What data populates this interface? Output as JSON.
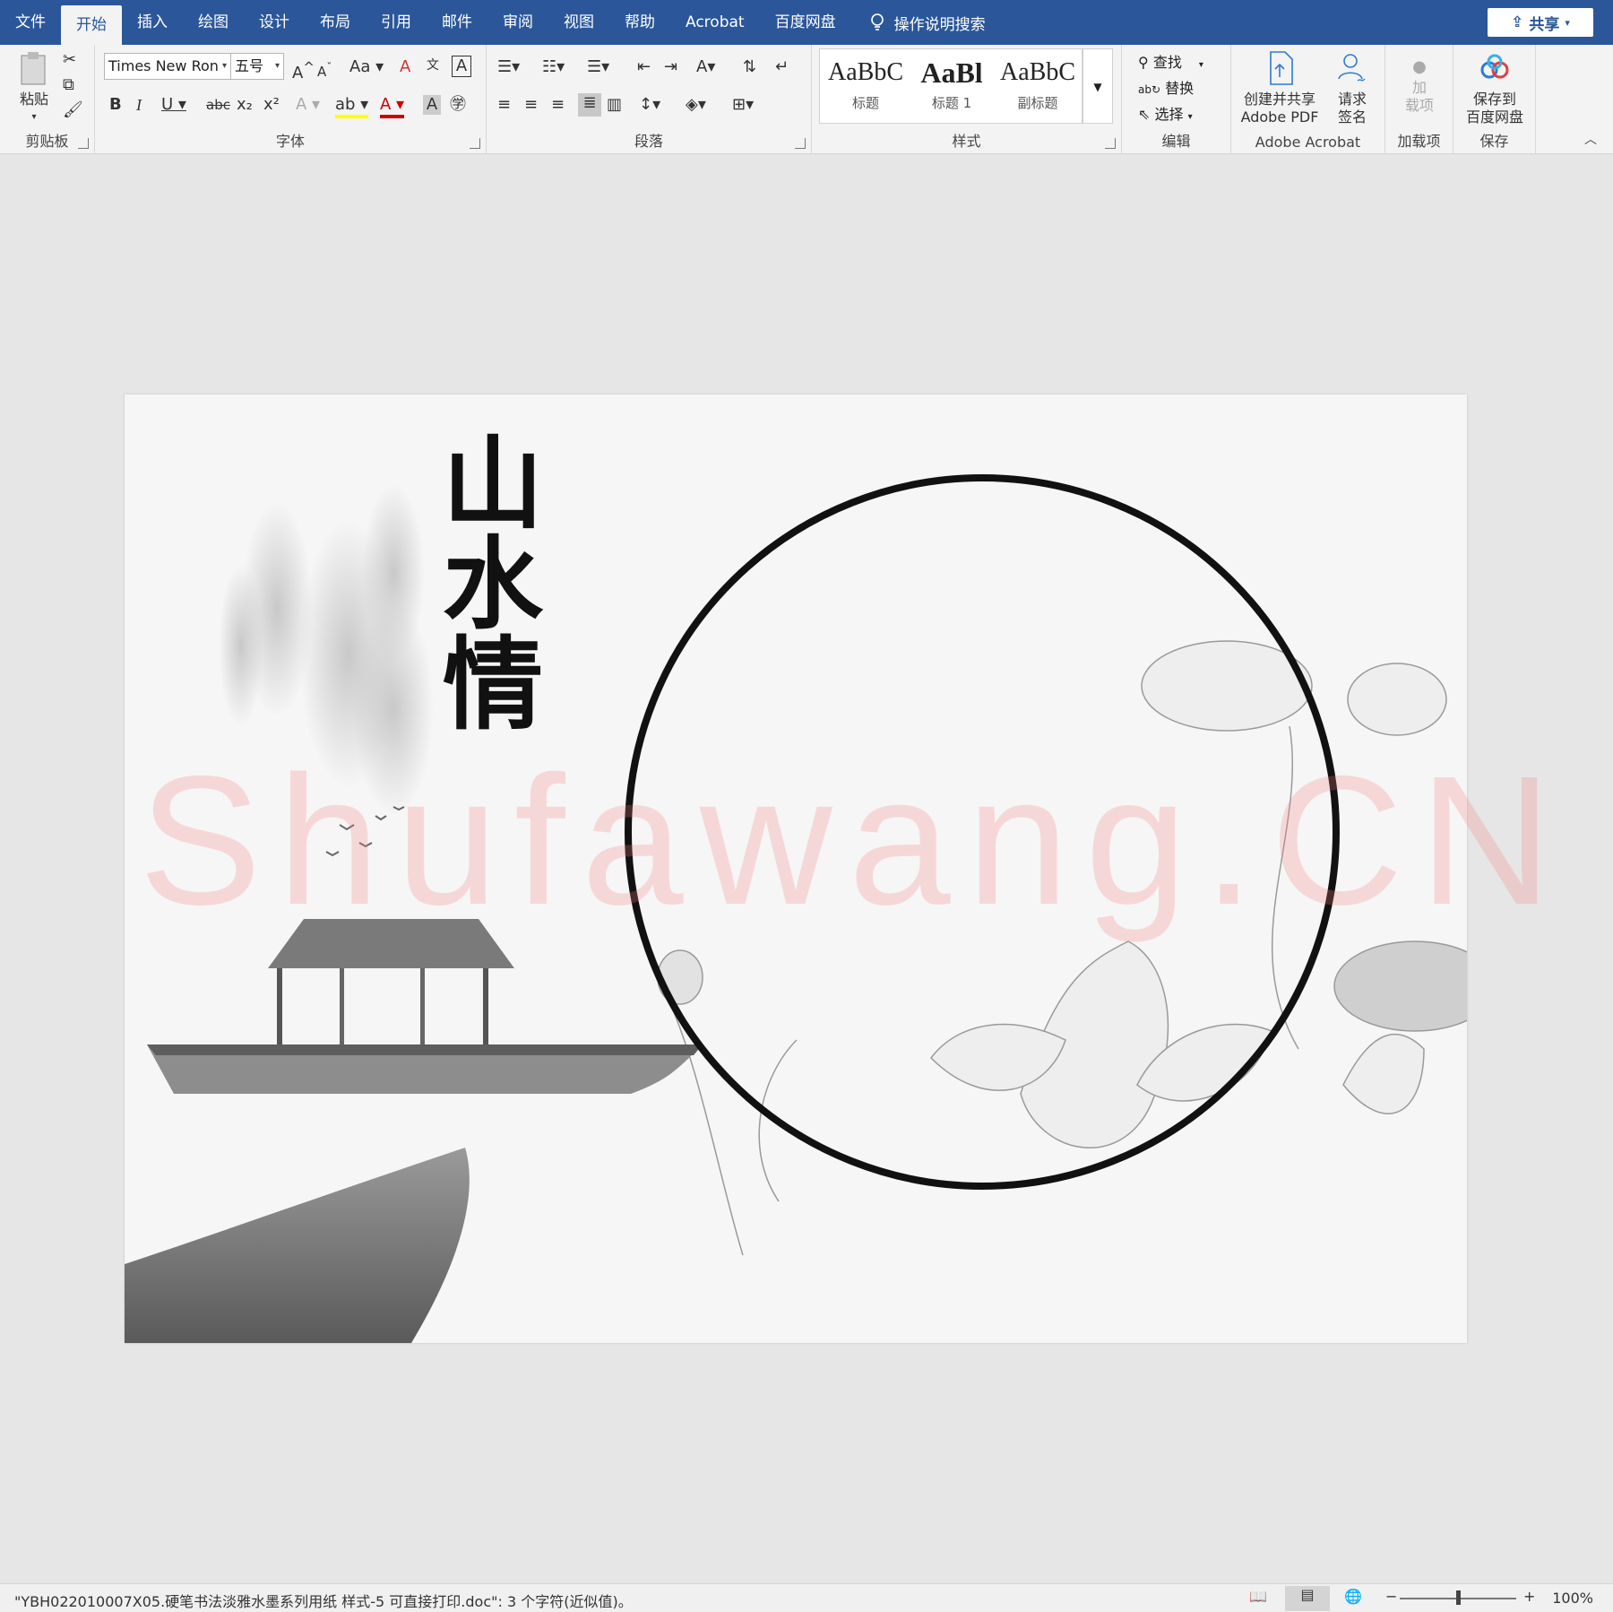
{
  "tabs": [
    "文件",
    "开始",
    "插入",
    "绘图",
    "设计",
    "布局",
    "引用",
    "邮件",
    "审阅",
    "视图",
    "帮助",
    "Acrobat",
    "百度网盘"
  ],
  "active_tab": "开始",
  "tell_me": "操作说明搜索",
  "share_label": "共享",
  "clipboard": {
    "paste": "粘贴",
    "group": "剪贴板"
  },
  "font": {
    "name": "Times New Ron",
    "size": "五号",
    "case": "Aa",
    "group": "字体"
  },
  "paragraph": {
    "group": "段落"
  },
  "styles": {
    "items": [
      {
        "preview": "AaBbC",
        "name": "标题"
      },
      {
        "preview": "AaBl",
        "name": "标题 1"
      },
      {
        "preview": "AaBbC",
        "name": "副标题"
      }
    ],
    "group": "样式"
  },
  "editing": {
    "find": "查找",
    "replace": "替换",
    "select": "选择",
    "group": "编辑"
  },
  "acrobat": {
    "create_line1": "创建并共享",
    "create_line2": "Adobe PDF",
    "sign_line1": "请求",
    "sign_line2": "签名",
    "group": "Adobe Acrobat"
  },
  "addins": {
    "line1": "加",
    "line2": "载项",
    "group": "加载项"
  },
  "save": {
    "line1": "保存到",
    "line2": "百度网盘",
    "group": "保存"
  },
  "document": {
    "title_glyphs": "山水情",
    "watermark": "Shufawang.CN"
  },
  "status": {
    "text": "\"YBH022010007X05.硬笔书法淡雅水墨系列用纸 样式-5 可直接打印.doc\": 3 个字符(近似值)。",
    "zoom": "100%"
  }
}
